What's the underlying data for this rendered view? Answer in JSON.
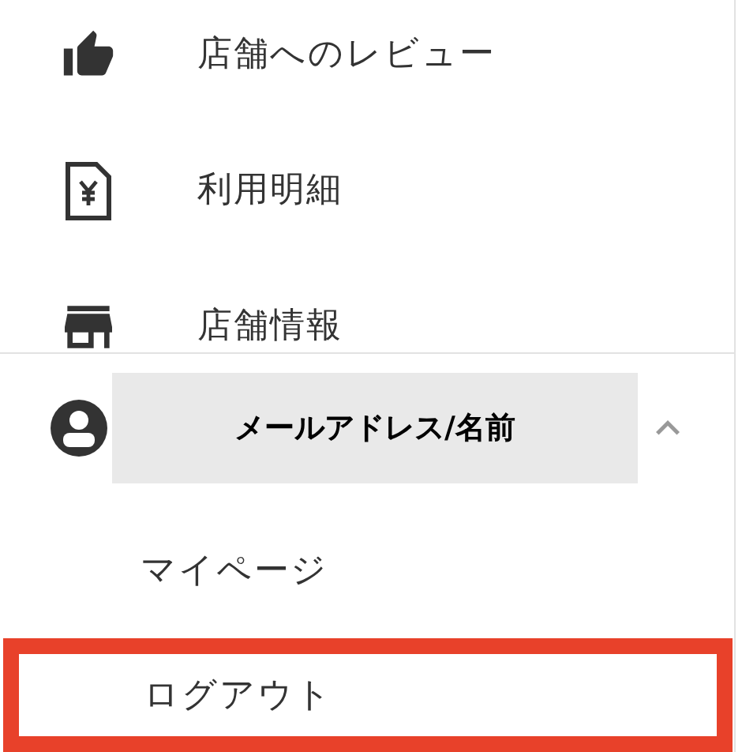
{
  "menu_items": [
    {
      "label": "店舗へのレビュー"
    },
    {
      "label": "利用明細"
    },
    {
      "label": "店舗情報"
    }
  ],
  "account": {
    "label": "メールアドレス/名前",
    "expanded": true
  },
  "account_menu": [
    {
      "label": "マイページ",
      "highlighted": false
    },
    {
      "label": "ログアウト",
      "highlighted": true
    }
  ]
}
